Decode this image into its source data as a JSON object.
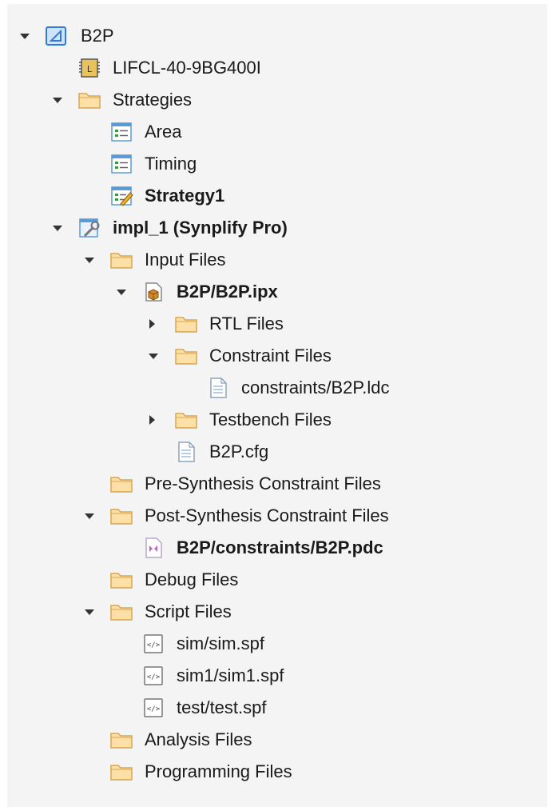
{
  "tree": {
    "project": {
      "label": "B2P",
      "icon": "project-icon"
    },
    "device": {
      "label": "LIFCL-40-9BG400I",
      "icon": "chip-icon"
    },
    "strategies": {
      "label": "Strategies",
      "icon": "folder-icon"
    },
    "strategy_area": {
      "label": "Area",
      "icon": "strategy-icon"
    },
    "strategy_timing": {
      "label": "Timing",
      "icon": "strategy-icon"
    },
    "strategy_1": {
      "label": "Strategy1",
      "icon": "strategy-active-icon"
    },
    "impl": {
      "label": "impl_1 (Synplify Pro)",
      "icon": "implementation-icon"
    },
    "input_files": {
      "label": "Input Files",
      "icon": "folder-icon"
    },
    "ipx": {
      "label": "B2P/B2P.ipx",
      "icon": "ip-package-icon"
    },
    "rtl_files": {
      "label": "RTL Files",
      "icon": "folder-icon"
    },
    "constraint_files": {
      "label": "Constraint Files",
      "icon": "folder-icon"
    },
    "ldc": {
      "label": "constraints/B2P.ldc",
      "icon": "document-icon"
    },
    "testbench_files": {
      "label": "Testbench Files",
      "icon": "folder-icon"
    },
    "cfg": {
      "label": "B2P.cfg",
      "icon": "document-icon"
    },
    "pre_synth": {
      "label": "Pre-Synthesis Constraint Files",
      "icon": "folder-icon"
    },
    "post_synth": {
      "label": "Post-Synthesis Constraint Files",
      "icon": "folder-icon"
    },
    "pdc": {
      "label": "B2P/constraints/B2P.pdc",
      "icon": "pdc-file-icon"
    },
    "debug_files": {
      "label": "Debug Files",
      "icon": "folder-icon"
    },
    "script_files": {
      "label": "Script Files",
      "icon": "folder-icon"
    },
    "sim_spf": {
      "label": "sim/sim.spf",
      "icon": "script-file-icon"
    },
    "sim1_spf": {
      "label": "sim1/sim1.spf",
      "icon": "script-file-icon"
    },
    "test_spf": {
      "label": "test/test.spf",
      "icon": "script-file-icon"
    },
    "analysis_files": {
      "label": "Analysis Files",
      "icon": "folder-icon"
    },
    "programming_files": {
      "label": "Programming Files",
      "icon": "folder-icon"
    }
  },
  "colors": {
    "panel_bg": "#f4f4f4",
    "folder_fill": "#fce0a8",
    "folder_stroke": "#d9a650",
    "project_blue": "#2f7bd6",
    "pdc_purple": "#c060c8"
  }
}
